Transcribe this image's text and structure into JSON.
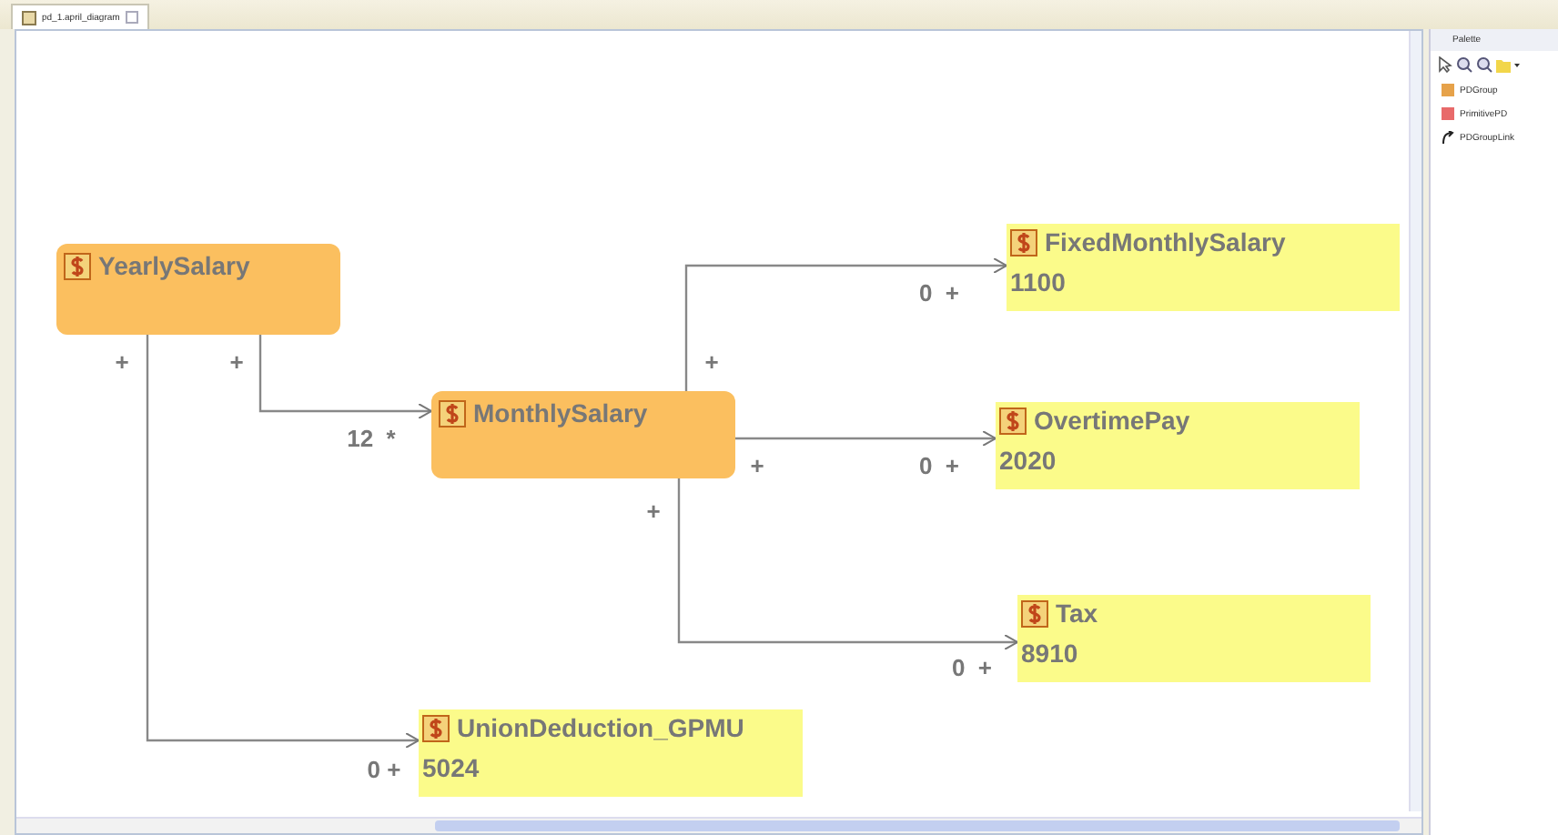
{
  "editor_tab": {
    "title": "pd_1.april_diagram",
    "selected": true
  },
  "nodes": [
    {
      "kind": "group",
      "name": "YearlySalary"
    },
    {
      "kind": "group",
      "name": "MonthlySalary"
    },
    {
      "kind": "primitive",
      "name": "FixedMonthlySalary",
      "value": "1100"
    },
    {
      "kind": "primitive",
      "name": "OvertimePay",
      "value": "2020"
    },
    {
      "kind": "primitive",
      "name": "Tax",
      "value": "8910"
    },
    {
      "kind": "primitive",
      "name": "UnionDeduction_GPMU",
      "value": "5024"
    }
  ],
  "edges": [
    {
      "source_label": "+",
      "target_label": "0 +"
    },
    {
      "source_label": "+",
      "target_label": "12  *"
    },
    {
      "source_label": "+",
      "target_label": "0  +"
    },
    {
      "source_label": "+",
      "target_label": "0  +"
    },
    {
      "source_label": "+",
      "target_label": "0  +"
    }
  ],
  "palette": {
    "title": "Palette",
    "items": [
      {
        "kind": "group",
        "label": "PDGroup"
      },
      {
        "kind": "primitive",
        "label": "PrimitivePD"
      },
      {
        "kind": "link",
        "label": "PDGroupLink"
      }
    ]
  }
}
